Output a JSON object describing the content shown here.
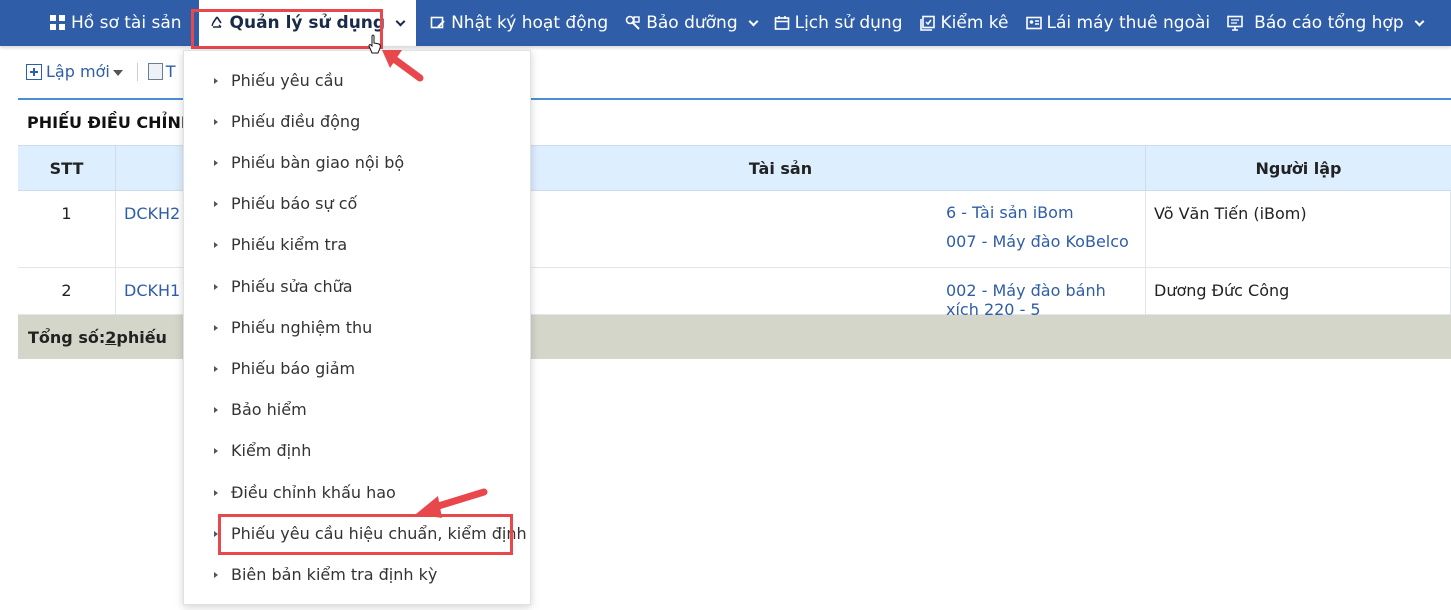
{
  "nav": {
    "items": [
      {
        "label": "Hồ sơ tài sản",
        "icon": "grid-icon"
      },
      {
        "label": "Quản lý sử dụng",
        "icon": "recycle-icon",
        "active": true
      },
      {
        "label": "Nhật ký hoạt động",
        "icon": "edit-icon"
      },
      {
        "label": "Bảo dưỡng",
        "icon": "wrench-icon"
      },
      {
        "label": "Lịch sử dụng",
        "icon": "calendar-icon"
      },
      {
        "label": "Kiểm kê",
        "icon": "checklist-icon"
      },
      {
        "label": "Lái máy thuê ngoài",
        "icon": "id-card-icon"
      },
      {
        "label": "Báo cáo tổng hợp",
        "icon": "monitor-icon"
      }
    ]
  },
  "toolbar": {
    "new_label": "Lập mới",
    "second_partial": "T"
  },
  "page": {
    "section_title": "PHIẾU ĐIỀU CHỈNH"
  },
  "table": {
    "headers": {
      "stt": "STT",
      "asset": "Tài sản",
      "creator": "Người lập"
    },
    "rows": [
      {
        "stt": "1",
        "code": "DCKH2",
        "assets": [
          "6 - Tài sản iBom",
          "007 - Máy đào KoBelco"
        ],
        "creator": "Võ Văn Tiến (iBom)"
      },
      {
        "stt": "2",
        "code": "DCKH1",
        "assets": [
          "002 - Máy đào bánh xích 220 - 5"
        ],
        "creator": "Dương Đức Công"
      }
    ],
    "footer": {
      "prefix": "Tổng số: ",
      "count": "2",
      "suffix": " phiếu"
    }
  },
  "dropdown": {
    "items": [
      "Phiếu yêu cầu",
      "Phiếu điều động",
      "Phiếu bàn giao nội bộ",
      "Phiếu báo sự cố",
      "Phiếu kiểm tra",
      "Phiếu sửa chữa",
      "Phiếu nghiệm thu",
      "Phiếu báo giảm",
      "Bảo hiểm",
      "Kiểm định",
      "Điều chỉnh khấu hao",
      "Phiếu yêu cầu hiệu chuẩn, kiểm định",
      "Biên bản kiểm tra định kỳ"
    ],
    "highlighted_index": 11
  },
  "colors": {
    "nav_bg": "#2f5da8",
    "highlight": "#e8474c",
    "link": "#2f5da8"
  }
}
